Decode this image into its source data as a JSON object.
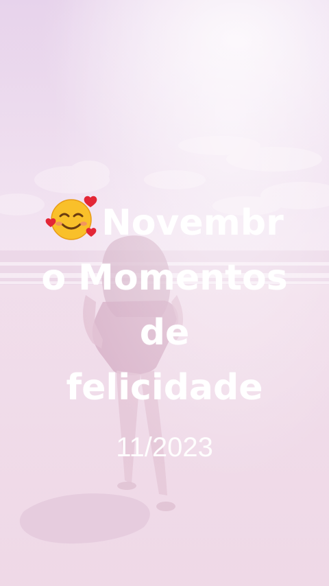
{
  "caption": {
    "emoji_icon": "smiling-face-with-hearts",
    "line1": "Novembr",
    "line2": "o Momentos",
    "line3": "de",
    "line4": "felicidade"
  },
  "date": "11/2023",
  "colors": {
    "text": "#ffffff",
    "tint": "#f0dcec"
  }
}
